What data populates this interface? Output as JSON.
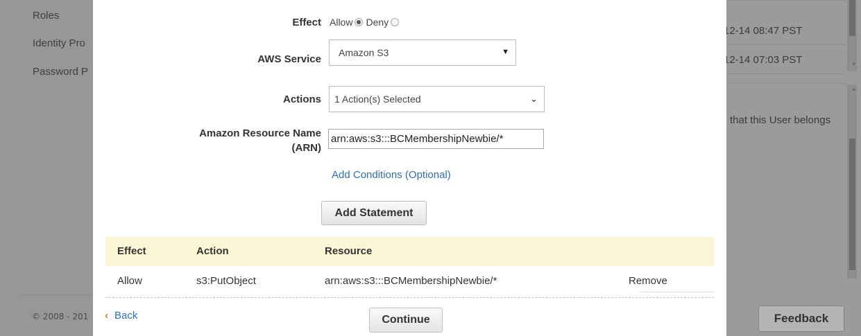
{
  "background": {
    "nav_items": [
      "Roles",
      "Identity Pro",
      "Password P"
    ],
    "copyright": "© 2008 - 201",
    "timestamps": [
      "12-14 08:47 PST",
      "12-14 07:03 PST"
    ],
    "note": "that this User belongs",
    "feedback_label": "Feedback"
  },
  "form": {
    "effect_label": "Effect",
    "effect_allow": "Allow",
    "effect_deny": "Deny",
    "effect_selected": "Allow",
    "service_label": "AWS Service",
    "service_value": "Amazon S3",
    "actions_label": "Actions",
    "actions_value": "1 Action(s) Selected",
    "arn_label_1": "Amazon Resource Name",
    "arn_label_2": "(ARN)",
    "arn_value": "arn:aws:s3:::BCMembershipNewbie/*",
    "add_conditions_link": "Add Conditions (Optional)",
    "add_statement_label": "Add Statement"
  },
  "statements": {
    "columns": [
      "Effect",
      "Action",
      "Resource"
    ],
    "rows": [
      {
        "effect": "Allow",
        "action": "s3:PutObject",
        "resource": "arn:aws:s3:::BCMembershipNewbie/*",
        "remove": "Remove"
      }
    ]
  },
  "footer": {
    "back_icon": "‹",
    "back_label": "Back",
    "continue_label": "Continue"
  },
  "colors": {
    "link": "#2c6fb4",
    "table_header_bg": "#fbf7d6",
    "overlay": "#9a9a9a"
  }
}
